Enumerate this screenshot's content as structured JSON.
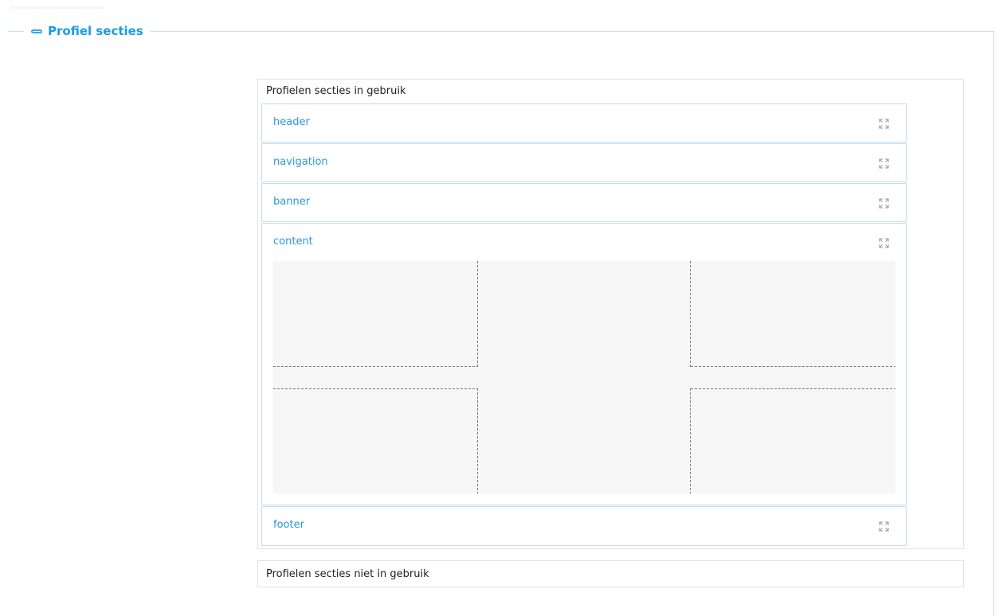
{
  "fieldset": {
    "legend": "Profiel secties",
    "collapse_icon": "collapse-icon"
  },
  "in_use": {
    "title": "Profielen secties in gebruik",
    "sections": [
      {
        "label": "header",
        "icon": "expand-icon"
      },
      {
        "label": "navigation",
        "icon": "expand-icon"
      },
      {
        "label": "banner",
        "icon": "expand-icon"
      },
      {
        "label": "content",
        "icon": "expand-icon"
      },
      {
        "label": "footer",
        "icon": "expand-icon"
      }
    ]
  },
  "not_in_use": {
    "title": "Profielen secties niet in gebruik"
  },
  "colors": {
    "accent": "#1a9be8",
    "link": "#2a97e0",
    "border": "#c2dbf3",
    "grid_bg": "#f6f6f6"
  }
}
